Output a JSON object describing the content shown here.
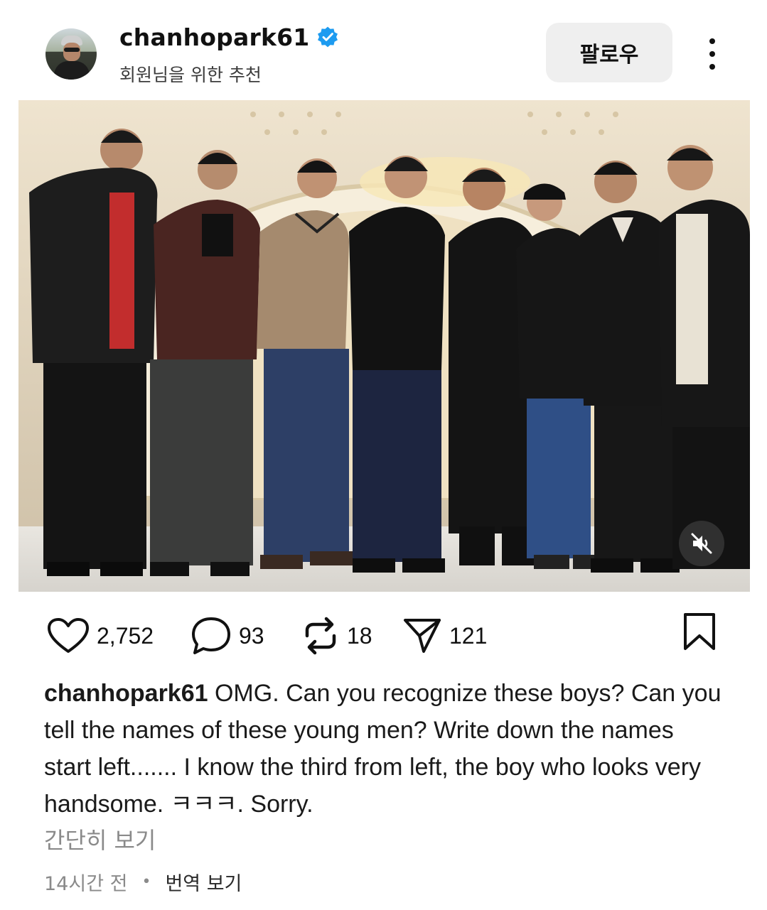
{
  "post": {
    "username": "chanhopark61",
    "subtitle": "회원님을 위한 추천",
    "follow_label": "팔로우",
    "more_icon": "more-vertical-icon",
    "verified_icon": "verified-badge-icon",
    "verified_color": "#1d9bf0"
  },
  "media": {
    "type": "photo",
    "mute_icon": "speaker-muted-icon"
  },
  "actions": {
    "likes": "2,752",
    "comments": "93",
    "reposts": "18",
    "shares": "121",
    "icons": [
      "heart-icon",
      "comment-icon",
      "repost-icon",
      "share-icon",
      "bookmark-icon"
    ]
  },
  "caption": {
    "username": "chanhopark61",
    "text": "OMG. Can you recognize these boys? Can you tell the names of these young men?  Write down the names start left....... I know the third from left, the boy who looks very handsome.  ㅋㅋㅋ.  Sorry.",
    "see_less": "간단히 보기"
  },
  "meta": {
    "time": "14시간 전",
    "separator": "•",
    "translate": "번역 보기"
  }
}
